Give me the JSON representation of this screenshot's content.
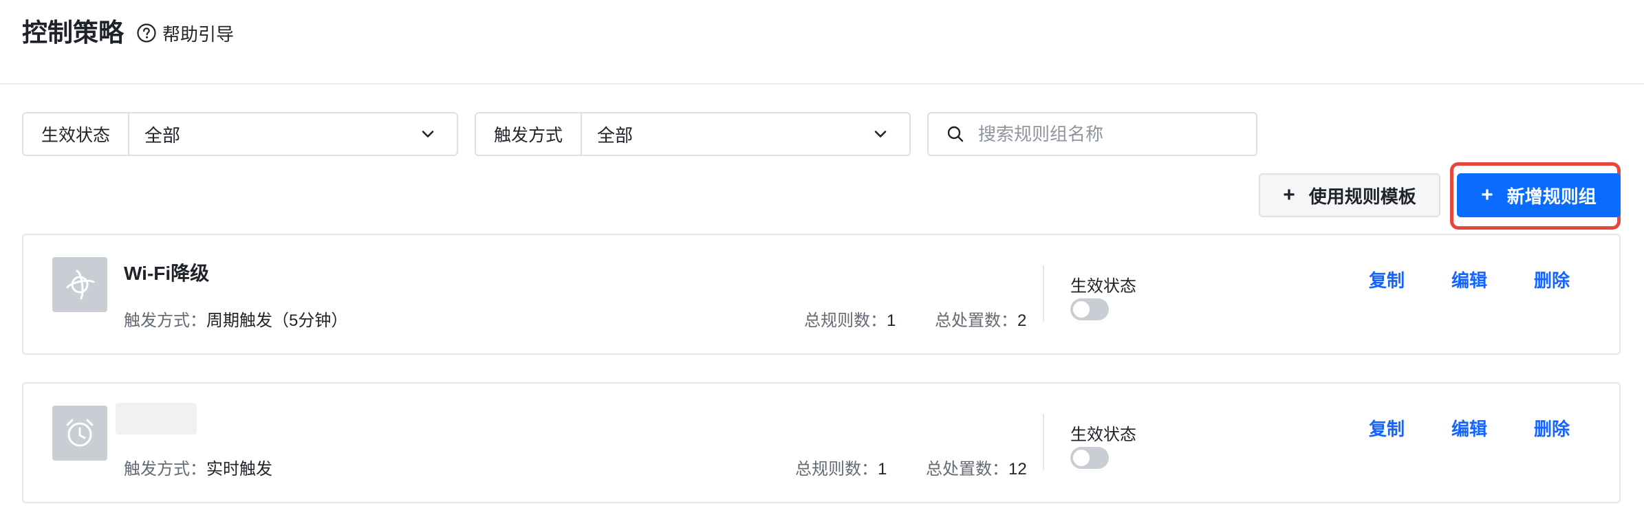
{
  "header": {
    "title": "控制策略",
    "help_label": "帮助引导",
    "help_icon": "question-circle-icon"
  },
  "filters": {
    "status": {
      "label": "生效状态",
      "value": "全部"
    },
    "trigger": {
      "label": "触发方式",
      "value": "全部"
    },
    "search": {
      "placeholder": "搜索规则组名称"
    }
  },
  "actions": {
    "template_label": "使用规则模板",
    "new_label": "新增规则组",
    "plus": "+"
  },
  "colors": {
    "primary": "#0a6cff",
    "link": "#1664ff",
    "highlight": "#e8453c"
  },
  "rule_groups": [
    {
      "name": "Wi-Fi降级",
      "icon": "orbit-icon",
      "trigger_label": "触发方式：",
      "trigger_value": "周期触发（5分钟）",
      "rules_label": "总规则数：",
      "rules_value": "1",
      "actions_label": "总处置数：",
      "actions_value": "2",
      "status_label": "生效状态",
      "enabled": false,
      "copy": "复制",
      "edit": "编辑",
      "delete": "删除"
    },
    {
      "name": "",
      "icon": "alarm-clock-icon",
      "trigger_label": "触发方式：",
      "trigger_value": "实时触发",
      "rules_label": "总规则数：",
      "rules_value": "1",
      "actions_label": "总处置数：",
      "actions_value": "12",
      "status_label": "生效状态",
      "enabled": false,
      "copy": "复制",
      "edit": "编辑",
      "delete": "删除"
    }
  ]
}
